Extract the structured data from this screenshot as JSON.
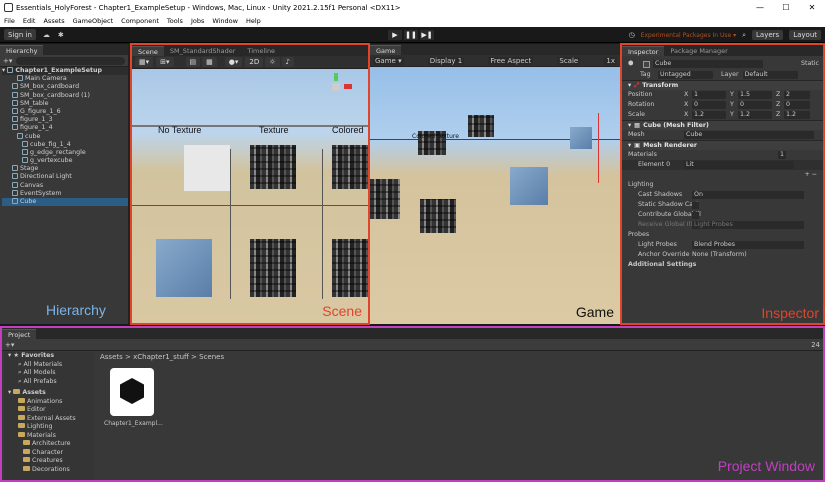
{
  "window": {
    "title": "Essentials_HolyForest - Chapter1_ExampleSetup - Windows, Mac, Linux - Unity 2021.2.15f1 Personal <DX11>",
    "minimize": "—",
    "maximize": "☐",
    "close": "✕"
  },
  "menu": [
    "File",
    "Edit",
    "Assets",
    "GameObject",
    "Component",
    "Tools",
    "Jobs",
    "Window",
    "Help"
  ],
  "toolbar": {
    "sign_in": "Sign in",
    "experimental": "Experimental Packages In Use ▾",
    "layers": "Layers",
    "layout": "Layout"
  },
  "hierarchy": {
    "tab": "Hierarchy",
    "scene": "Chapter1_ExampleSetup",
    "items": [
      {
        "label": "Main Camera",
        "indent": 3
      },
      {
        "label": "SM_box_cardboard",
        "indent": 2
      },
      {
        "label": "SM_box_cardboard (1)",
        "indent": 2
      },
      {
        "label": "SM_table",
        "indent": 2
      },
      {
        "label": "G_figure_1_6",
        "indent": 2
      },
      {
        "label": "figure_1_3",
        "indent": 2
      },
      {
        "label": "figure_1_4",
        "indent": 2
      },
      {
        "label": "cube",
        "indent": 3
      },
      {
        "label": "cube_fig_1_4",
        "indent": 4
      },
      {
        "label": "g_edge_rectangle",
        "indent": 4
      },
      {
        "label": "g_vertexcube",
        "indent": 4
      },
      {
        "label": "Stage",
        "indent": 2
      },
      {
        "label": "Directional Light",
        "indent": 2
      },
      {
        "label": "Canvas",
        "indent": 2
      },
      {
        "label": "EventSystem",
        "indent": 2
      },
      {
        "label": "Cube",
        "indent": 2,
        "selected": true
      }
    ],
    "overlay": "Hierarchy"
  },
  "scene": {
    "tabs": [
      "Scene",
      "SM_StandardShader",
      "Timeline"
    ],
    "labels": [
      "No Texture",
      "Texture",
      "Colored"
    ],
    "overlay": "Scene",
    "mode": "2D"
  },
  "game": {
    "tab": "Game",
    "display": "Display 1",
    "aspect": "Free Aspect",
    "scale": "Scale",
    "scale_val": "1x",
    "labels": [
      "Colored Texture"
    ],
    "overlay": "Game"
  },
  "inspector": {
    "tabs": [
      "Inspector",
      "Package Manager"
    ],
    "name": "Cube",
    "static": "Static",
    "tag": "Untagged",
    "layer": "Default",
    "tag_label": "Tag",
    "layer_label": "Layer",
    "transform": {
      "title": "Transform",
      "rows": [
        {
          "label": "Position",
          "x": "1",
          "y": "1.5",
          "z": "2"
        },
        {
          "label": "Rotation",
          "x": "0",
          "y": "0",
          "z": "0"
        },
        {
          "label": "Scale",
          "x": "1.2",
          "y": "1.2",
          "z": "1.2"
        }
      ]
    },
    "meshfilter": {
      "title": "Cube (Mesh Filter)",
      "label": "Mesh",
      "value": "Cube"
    },
    "renderer": {
      "title": "Mesh Renderer",
      "materials": "Materials",
      "count": "1",
      "element": "Element 0",
      "mat": "Lit",
      "lighting": "Lighting",
      "cast_shadows": "Cast Shadows",
      "cast_val": "On",
      "static_cast": "Static Shadow Cast",
      "contrib": "Contribute Global Ill",
      "receive": "Receive Global Illum",
      "receive_val": "Light Probes",
      "probes": "Probes",
      "light_probes": "Light Probes",
      "lp_val": "Blend Probes",
      "anchor": "Anchor Override",
      "anchor_val": "None (Transform)",
      "additional": "Additional Settings"
    },
    "overlay": "Inspector"
  },
  "project": {
    "tab": "Project",
    "favorites": "Favorites",
    "fav_items": [
      "All Materials",
      "All Models",
      "All Prefabs"
    ],
    "assets": "Assets",
    "asset_items": [
      {
        "label": "Animations",
        "indent": 2
      },
      {
        "label": "Editor",
        "indent": 2
      },
      {
        "label": "External Assets",
        "indent": 2
      },
      {
        "label": "Lighting",
        "indent": 2
      },
      {
        "label": "Materials",
        "indent": 2
      },
      {
        "label": "Architecture",
        "indent": 3
      },
      {
        "label": "Character",
        "indent": 3
      },
      {
        "label": "Creatures",
        "indent": 3
      },
      {
        "label": "Decorations",
        "indent": 3
      }
    ],
    "breadcrumb": "Assets > xChapter1_stuff > Scenes",
    "file": "Chapter1_Exampl...",
    "count": "24",
    "overlay": "Project Window"
  }
}
